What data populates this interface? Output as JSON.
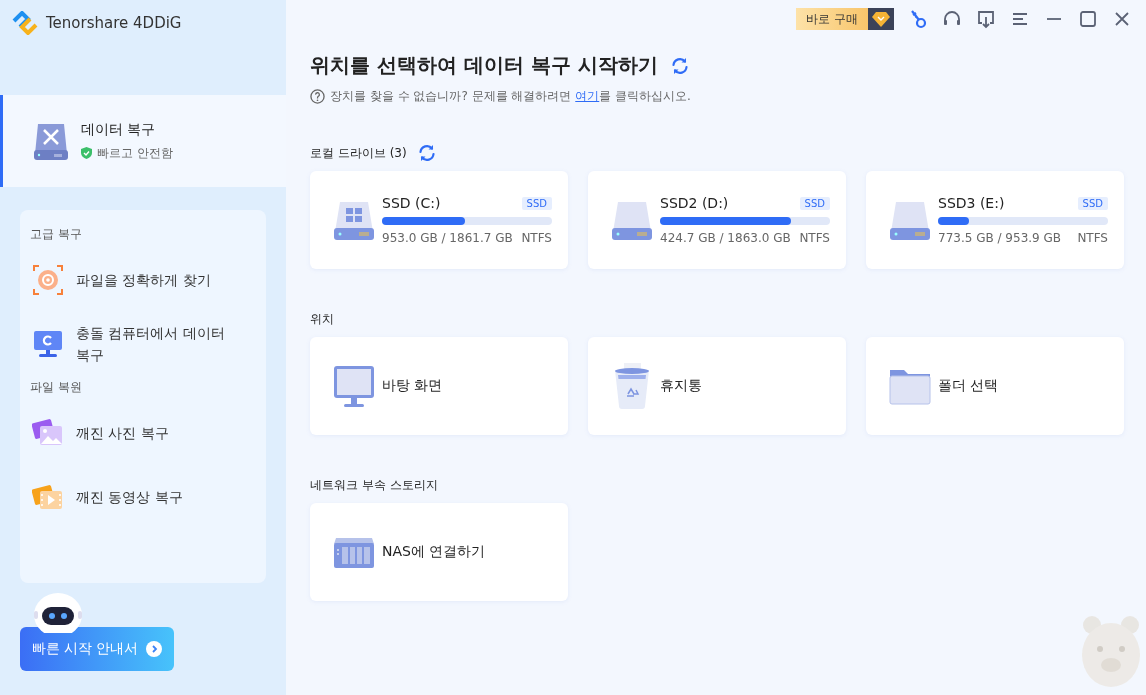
{
  "app": {
    "name": "Tenorshare 4DDiG"
  },
  "toolbar": {
    "purchase": "바로 구매"
  },
  "nav": [
    {
      "title": "데이터 복구",
      "subtitle": "빠르고 안전함",
      "selected": true
    }
  ],
  "sidebar_sections": [
    {
      "heading": "고급 복구",
      "items": [
        {
          "label": "파일을 정확하게 찾기",
          "kind": "target"
        },
        {
          "label": "충돌 컴퓨터에서 데이터 복구",
          "kind": "monitor"
        }
      ]
    },
    {
      "heading": "파일 복원",
      "items": [
        {
          "label": "깨진 사진 복구",
          "kind": "photo"
        },
        {
          "label": "깨진 동영상 복구",
          "kind": "video"
        }
      ]
    }
  ],
  "guide_button": {
    "label": "빠른 시작 안내서"
  },
  "heading": "위치를 선택하여 데이터 복구 시작하기",
  "help": {
    "before": "장치를 찾을 수 없습니까? 문제를 해결하려면 ",
    "link": "여기",
    "after": "를 클릭하십시오."
  },
  "local_drives": {
    "title": "로컬 드라이브 (3)",
    "drives": [
      {
        "name": "SSD (C:)",
        "tag": "SSD",
        "level": 0.49,
        "usage": "953.0 GB / 1861.7 GB",
        "filesystem": "NTFS",
        "kind": "system"
      },
      {
        "name": "SSD2 (D:)",
        "tag": "SSD",
        "level": 0.77,
        "usage": "424.7 GB / 1863.0 GB",
        "filesystem": "NTFS",
        "kind": "plain"
      },
      {
        "name": "SSD3 (E:)",
        "tag": "SSD",
        "level": 0.18,
        "usage": "773.5 GB / 953.9 GB",
        "filesystem": "NTFS",
        "kind": "plain"
      }
    ]
  },
  "locations": {
    "title": "위치",
    "items": [
      {
        "label": "바탕 화면",
        "kind": "desktop"
      },
      {
        "label": "휴지통",
        "kind": "trash"
      },
      {
        "label": "폴더 선택",
        "kind": "folder"
      }
    ]
  },
  "network": {
    "title": "네트워크 부속 스토리지",
    "items": [
      {
        "label": "NAS에 연결하기",
        "kind": "nas"
      }
    ]
  }
}
